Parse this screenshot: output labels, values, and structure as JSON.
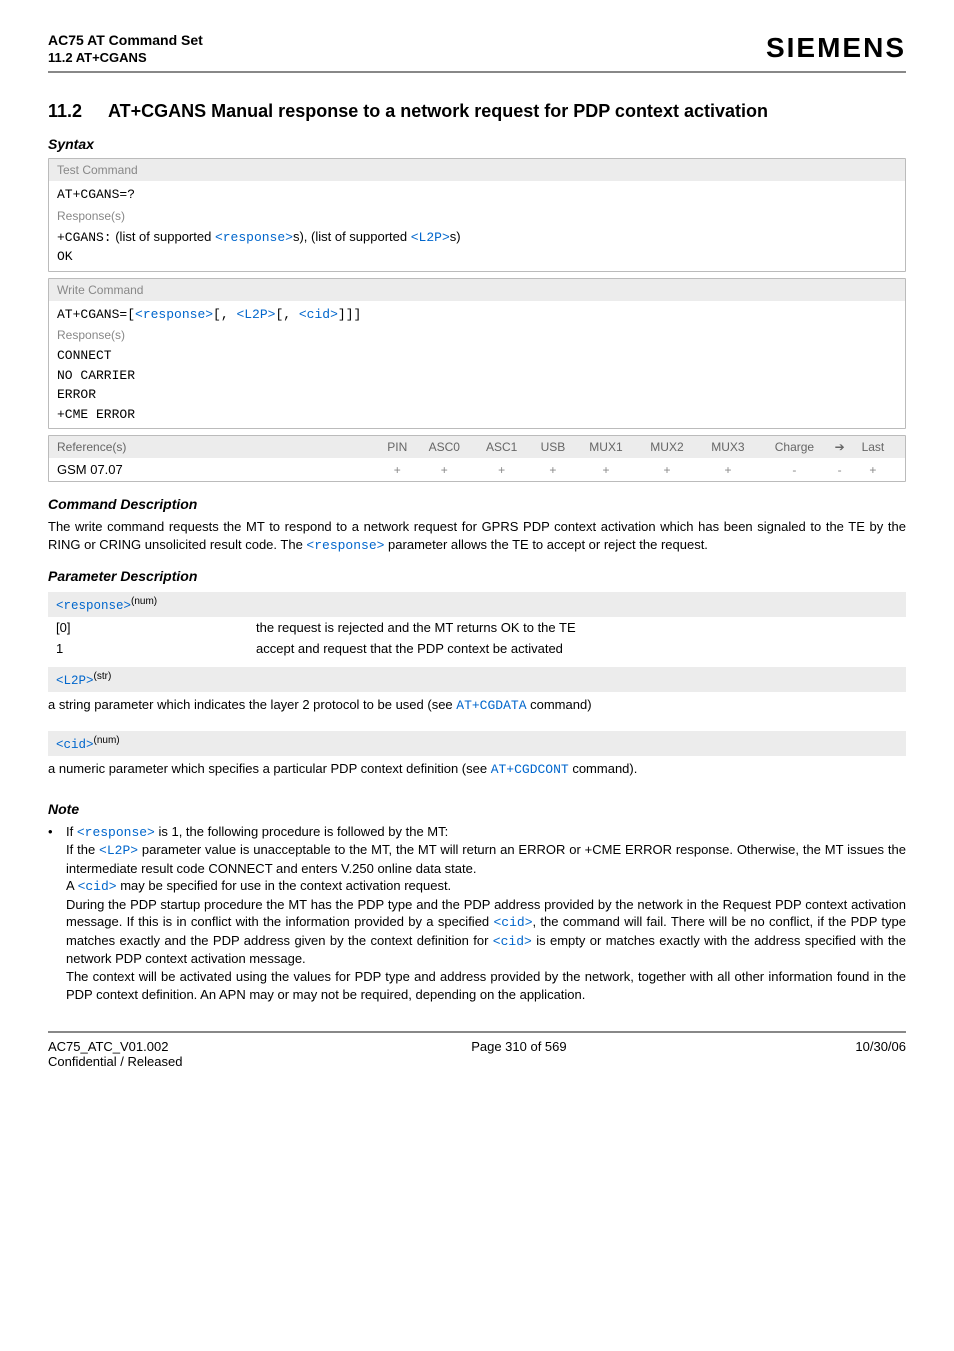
{
  "header": {
    "doc_title": "AC75 AT Command Set",
    "doc_sub": "11.2 AT+CGANS",
    "brand": "SIEMENS"
  },
  "section": {
    "num": "11.2",
    "title": "AT+CGANS   Manual response to a network request for PDP context activation"
  },
  "subheadings": {
    "syntax": "Syntax",
    "cmd_desc": "Command Description",
    "param_desc": "Parameter Description",
    "note": "Note"
  },
  "syntax": {
    "test": {
      "label": "Test Command",
      "cmd": "AT+CGANS=?",
      "resp_label": "Response(s)",
      "resp_prefix": "+CGANS:",
      "resp_text1": " (list of supported ",
      "resp_param1": "<response>",
      "resp_text2": "s), (list of supported ",
      "resp_param2": "<L2P>",
      "resp_text3": "s)",
      "ok": "OK"
    },
    "write": {
      "label": "Write Command",
      "cmd_prefix": "AT+CGANS=",
      "p1": "<response>",
      "p2": "<L2P>",
      "p3": "<cid>",
      "resp_label": "Response(s)",
      "l1": "CONNECT",
      "l2": "NO CARRIER",
      "l3": "ERROR",
      "l4": "+CME ERROR"
    }
  },
  "ref": {
    "head_ref": "Reference(s)",
    "cols": [
      "PIN",
      "ASC0",
      "ASC1",
      "USB",
      "MUX1",
      "MUX2",
      "MUX3",
      "Charge",
      "➔",
      "Last"
    ],
    "row_label": "GSM 07.07",
    "vals": [
      "+",
      "+",
      "+",
      "+",
      "+",
      "+",
      "+",
      "-",
      "-",
      "+"
    ]
  },
  "cmd_desc": {
    "t1": "The write command requests the MT to respond to a network request for GPRS PDP context activation which has been signaled to the TE by the RING or CRING unsolicited result code. The ",
    "p1": "<response>",
    "t2": " parameter allows the TE to accept or reject the request."
  },
  "params": {
    "response": {
      "name": "<response>",
      "type": "(num)",
      "rows": [
        {
          "k": "[0]",
          "d": "the request is rejected and the MT returns OK to the TE"
        },
        {
          "k": "1",
          "d": "accept and request that the PDP context be activated"
        }
      ]
    },
    "l2p": {
      "name": "<L2P>",
      "type": "(str)",
      "t1": "a string parameter which indicates the layer 2 protocol to be used (see ",
      "link": "AT+CGDATA",
      "t2": " command)"
    },
    "cid": {
      "name": "<cid>",
      "type": "(num)",
      "t1": "a numeric parameter which specifies a particular PDP context definition (see ",
      "link": "AT+CGDCONT",
      "t2": " command)."
    }
  },
  "note": {
    "bullet": "•",
    "t1": "If ",
    "p1": "<response>",
    "t2": " is 1, the following procedure is followed by the MT:",
    "t3": "If the ",
    "p2": "<L2P>",
    "t4": " parameter value is unacceptable to the MT, the MT will return an ERROR or +CME ERROR response. Otherwise, the MT issues the intermediate result code CONNECT and enters V.250 online data state.",
    "t5": "A ",
    "p3": "<cid>",
    "t6": " may be specified for use in the context activation request.",
    "t7": "During the PDP startup procedure the MT has the PDP type and the PDP address provided by the network in the Request PDP context activation message. If this is in conflict with the information provided by a specified ",
    "p4": "<cid>",
    "t8": ", the command will fail. There will be no conflict, if the PDP type matches exactly and the PDP address given by the context definition for ",
    "p5": "<cid>",
    "t9": " is empty or matches exactly with the address specified with the network PDP context activation message.",
    "t10": "The context will be activated using the values for PDP type and address provided by the network, together with all other information found in the PDP context definition. An APN may or may not be required, depending on the application."
  },
  "footer": {
    "left1": "AC75_ATC_V01.002",
    "left2": "Confidential / Released",
    "center": "Page 310 of 569",
    "right": "10/30/06"
  }
}
